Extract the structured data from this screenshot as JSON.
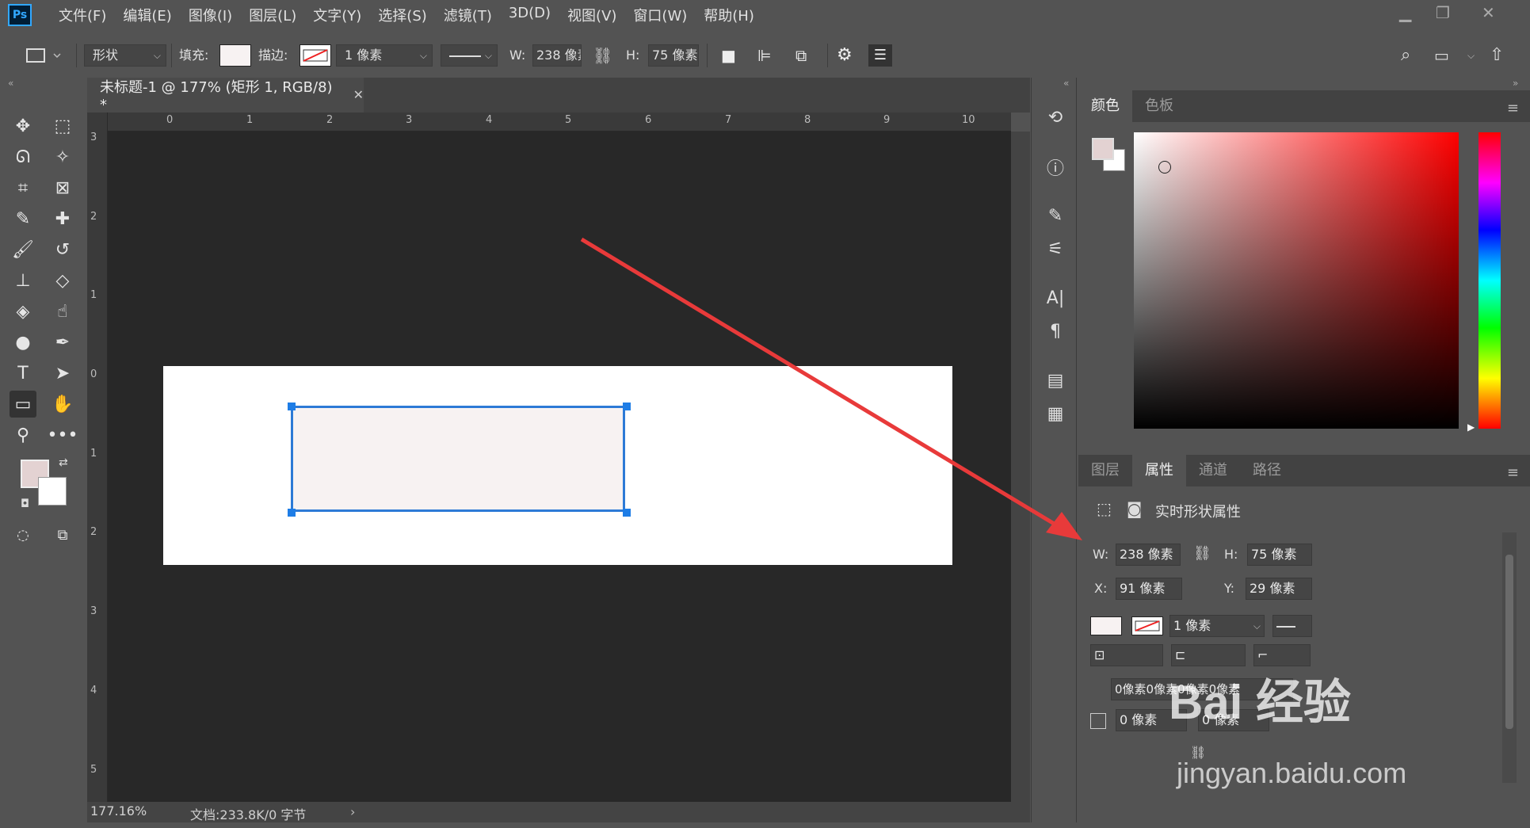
{
  "app": {
    "logo": "Ps"
  },
  "menu": [
    "文件(F)",
    "编辑(E)",
    "图像(I)",
    "图层(L)",
    "文字(Y)",
    "选择(S)",
    "滤镜(T)",
    "3D(D)",
    "视图(V)",
    "窗口(W)",
    "帮助(H)"
  ],
  "options": {
    "mode": "形状",
    "fill_label": "填充:",
    "stroke_label": "描边:",
    "stroke_width": "1 像素",
    "w_label": "W:",
    "w_value": "238 像素",
    "h_label": "H:",
    "h_value": "75 像素"
  },
  "document": {
    "tab_title": "未标题-1 @ 177% (矩形 1, RGB/8) *",
    "zoom": "177.16%",
    "doc_info": "文档:233.8K/0 字节",
    "ruler_top": [
      "0",
      "1",
      "2",
      "3",
      "4",
      "5",
      "6",
      "7",
      "8",
      "9",
      "10"
    ],
    "ruler_left": [
      "3",
      "2",
      "1",
      "0",
      "1",
      "2",
      "3",
      "4",
      "5"
    ]
  },
  "color_panel": {
    "tabs": [
      "颜色",
      "色板"
    ],
    "active_tab": "颜色",
    "foreground": "#e3d2d2",
    "background": "#ffffff"
  },
  "properties_panel": {
    "tabs": [
      "图层",
      "属性",
      "通道",
      "路径"
    ],
    "active_tab": "属性",
    "title": "实时形状属性",
    "w_label": "W:",
    "w_value": "238 像素",
    "h_label": "H:",
    "h_value": "75 像素",
    "x_label": "X:",
    "x_value": "91 像素",
    "y_label": "Y:",
    "y_value": "29 像素",
    "stroke_width": "1 像素",
    "corner_radii": "0像素0像素0像素0像素",
    "corner_tl": "0 像素",
    "corner_tr": "0 像素"
  },
  "watermark": {
    "line1": "Bai 经验",
    "line2": "jingyan.baidu.com"
  },
  "colors": {
    "accent": "#2d7ad6",
    "arrow": "#e83a3a"
  }
}
